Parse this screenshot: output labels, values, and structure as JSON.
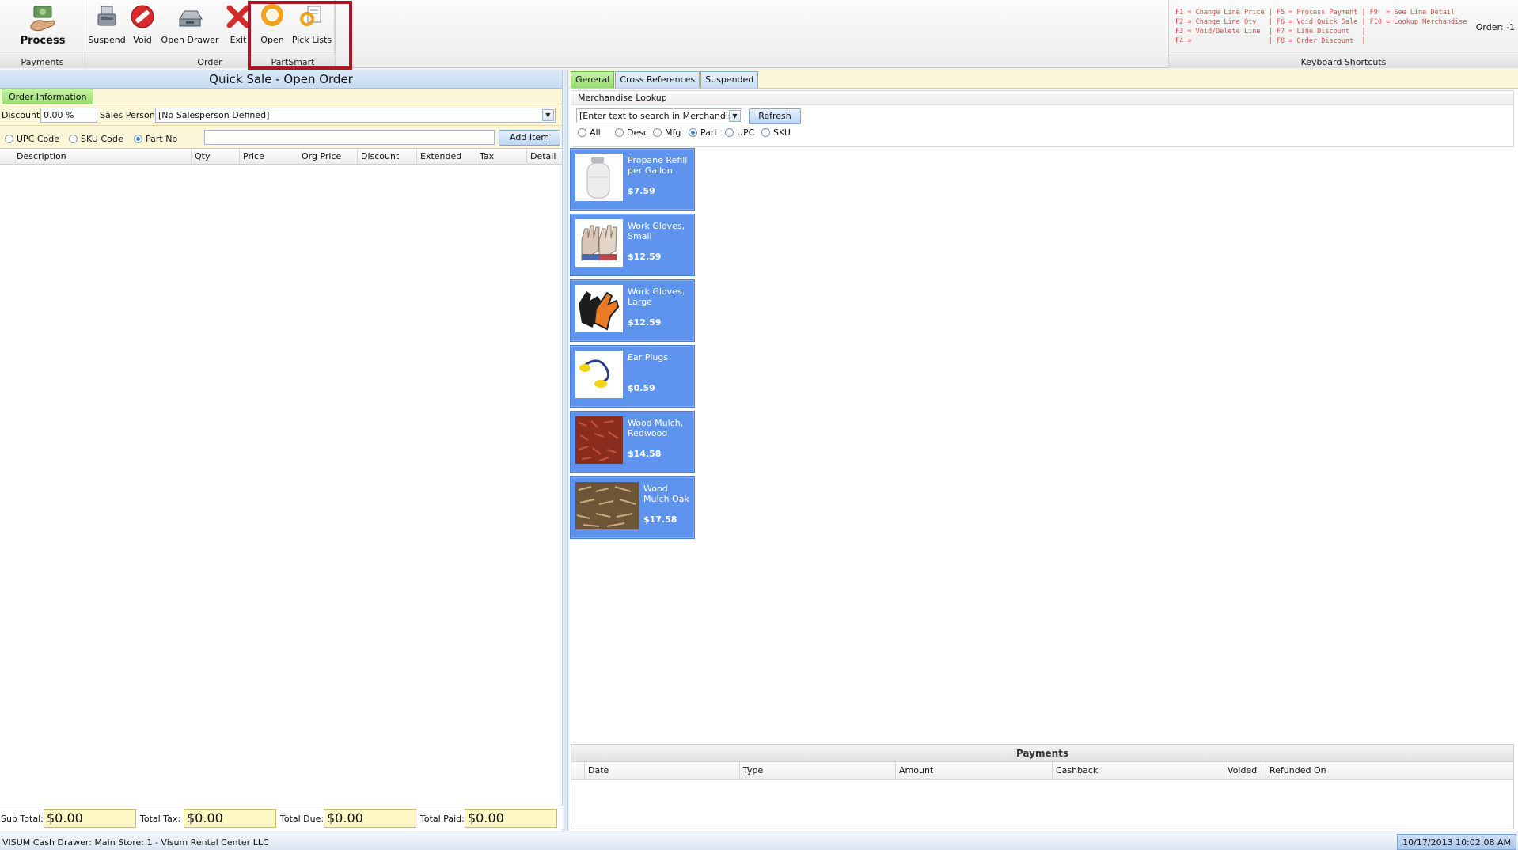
{
  "ribbon": {
    "groups": {
      "payments": "Payments",
      "order": "Order",
      "partsmart": "PartSmart",
      "shortcuts": "Keyboard Shortcuts"
    },
    "buttons": {
      "process": "Process",
      "suspend": "Suspend",
      "void": "Void",
      "open_drawer": "Open Drawer",
      "exit": "Exit",
      "open": "Open",
      "pick_lists": "Pick Lists"
    },
    "shortcuts_text": "F1 = Change Line Price | F5 = Process Payment | F9  = See Line Detail\nF2 = Change Line Qty   | F6 = Void Quick Sale | F10 = Lookup Merchandise\nF3 = Void/Delete Line  | F7 = Line Discount   |\nF4 =                   | F8 = Order Discount  |",
    "order_number": "Order: -1"
  },
  "left": {
    "title": "Quick Sale - Open Order",
    "tab": "Order Information",
    "discount_label": "Discount:",
    "discount_value": "0.00 %",
    "salesperson_label": "Sales Person:",
    "salesperson_value": "[No Salesperson Defined]",
    "lookup_options": [
      "UPC Code",
      "SKU Code",
      "Part No"
    ],
    "add_item": "Add Item",
    "columns": [
      "Description",
      "Qty",
      "Price",
      "Org Price",
      "Discount",
      "Extended",
      "Tax",
      "Detail"
    ],
    "totals": {
      "sub_total_label": "Sub Total:",
      "sub_total": "$0.00",
      "total_tax_label": "Total Tax:",
      "total_tax": "$0.00",
      "total_due_label": "Total Due:",
      "total_due": "$0.00",
      "total_paid_label": "Total Paid:",
      "total_paid": "$0.00"
    }
  },
  "right": {
    "tabs": [
      "General",
      "Cross References",
      "Suspended"
    ],
    "merch_title": "Merchandise Lookup",
    "search_placeholder": "[Enter text to search in Merchandise]",
    "refresh": "Refresh",
    "filters": [
      "All",
      "Desc",
      "Mfg",
      "Part",
      "UPC",
      "SKU"
    ],
    "items": [
      {
        "name": "Propane Refill per Gallon",
        "price": "$7.59",
        "icon": "propane-tank"
      },
      {
        "name": "Work Gloves, Small",
        "price": "$12.59",
        "icon": "work-gloves"
      },
      {
        "name": "Work Gloves, Large",
        "price": "$12.59",
        "icon": "orange-gloves"
      },
      {
        "name": "Ear Plugs",
        "price": "$0.59",
        "icon": "ear-plugs"
      },
      {
        "name": "Wood Mulch, Redwood",
        "price": "$14.58",
        "icon": "red-mulch"
      },
      {
        "name": "Wood Mulch Oak",
        "price": "$17.58",
        "icon": "oak-mulch"
      }
    ],
    "payments": {
      "title": "Payments",
      "columns": [
        "Date",
        "Type",
        "Amount",
        "Cashback",
        "Voided",
        "Refunded On"
      ]
    }
  },
  "status": {
    "text": "VISUM   Cash Drawer: Main   Store: 1 - Visum Rental Center LLC",
    "clock": "10/17/2013 10:02:08 AM"
  },
  "colors": {
    "accent_blue": "#5f94ee",
    "highlight_red": "#b0161f",
    "active_tab_green": "#96da6f",
    "totals_yellow": "#fdf8c4"
  }
}
